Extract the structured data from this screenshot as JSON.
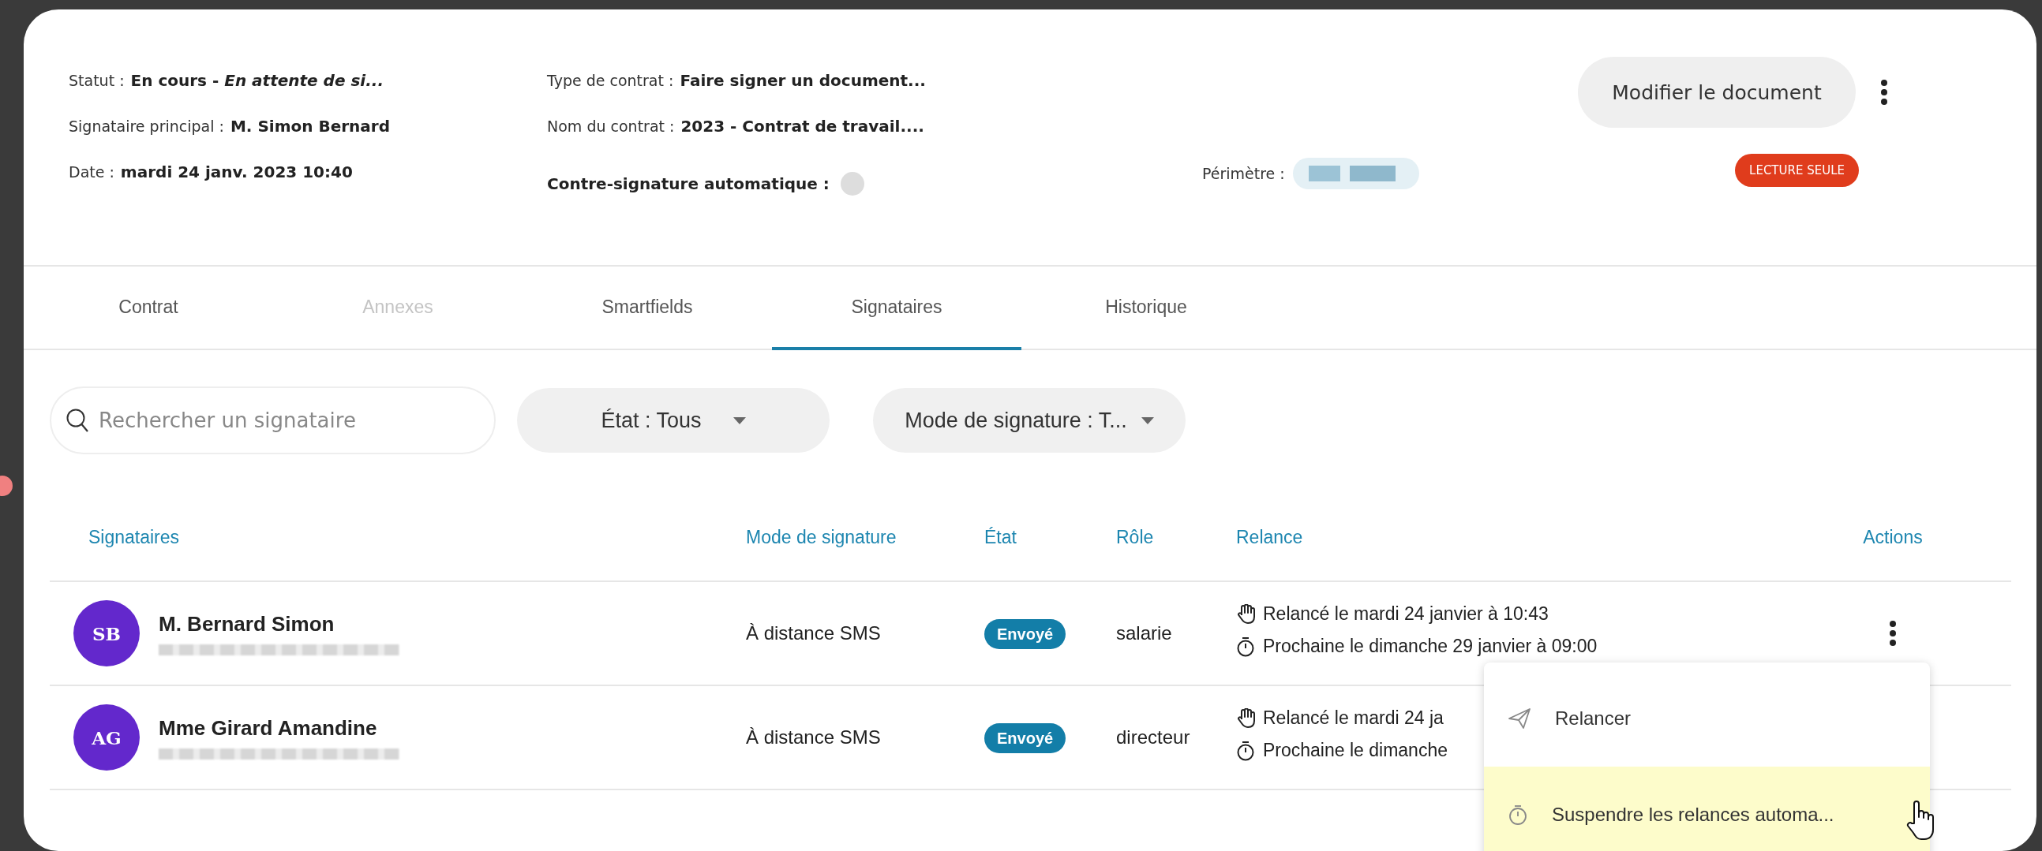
{
  "header": {
    "left_fields": [
      {
        "label": "Statut :",
        "value": "En cours - *En attente de si...*"
      },
      {
        "label": "Signataire principal :",
        "value": "M. Simon Bernard"
      },
      {
        "label": "Date :",
        "value": "mardi 24 janv. 2023 10:40"
      }
    ],
    "middle_fields": [
      {
        "label": "Type de contrat :",
        "value": "Faire signer un document..."
      },
      {
        "label": "Nom du contrat :",
        "value": "2023 - Contrat de travail...."
      }
    ],
    "auto_countersign": {
      "label": "Contre-signature automatique :",
      "on": false
    },
    "perimeter_label": "Périmètre :",
    "edit_button": "Modifier le document",
    "readonly_badge": "LECTURE SEULE"
  },
  "tabs": [
    {
      "label": "Contrat",
      "selected": false,
      "disabled": false
    },
    {
      "label": "Annexes",
      "selected": false,
      "disabled": true
    },
    {
      "label": "Smartfields",
      "selected": false,
      "disabled": false
    },
    {
      "label": "Signataires",
      "selected": true,
      "disabled": false
    },
    {
      "label": "Historique",
      "selected": false,
      "disabled": false
    }
  ],
  "search": {
    "placeholder": "Rechercher un signataire"
  },
  "filters": [
    {
      "label": "État : Tous"
    },
    {
      "label": "Mode de signature : T..."
    }
  ],
  "table": {
    "columns": [
      "Signataires",
      "Mode de signature",
      "État",
      "Rôle",
      "Relance",
      "Actions"
    ],
    "rows": [
      {
        "initials": "SB",
        "name": "M. Bernard Simon",
        "mode": "À distance SMS",
        "state": "Envoyé",
        "role": "salarie",
        "reminded": "Relancé le mardi 24 janvier à 10:43",
        "next": "Prochaine le dimanche 29 janvier à 09:00",
        "has_actions": true
      },
      {
        "initials": "AG",
        "name": "Mme Girard Amandine",
        "mode": "À distance SMS",
        "state": "Envoyé",
        "role": "directeur",
        "reminded": "Relancé le mardi 24 ja",
        "next": "Prochaine le dimanche"
      }
    ]
  },
  "menu": [
    {
      "kind": "send",
      "label": "Relancer",
      "highlighted": false
    },
    {
      "kind": "timer",
      "label": "Suspendre les relances automa...",
      "highlighted": true
    }
  ]
}
